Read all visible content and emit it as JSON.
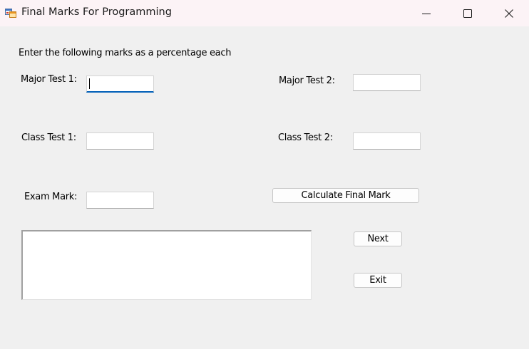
{
  "window": {
    "title": "Final Marks For Programming",
    "app_icon": "windows-form-icon",
    "controls": {
      "minimize_icon": "minimize-icon",
      "maximize_icon": "maximize-icon",
      "close_icon": "close-icon"
    }
  },
  "form": {
    "instruction": "Enter the following marks as a percentage each",
    "fields": {
      "major_test_1": {
        "label": "Major Test 1:",
        "value": ""
      },
      "major_test_2": {
        "label": "Major Test 2:",
        "value": ""
      },
      "class_test_1": {
        "label": "Class Test 1:",
        "value": ""
      },
      "class_test_2": {
        "label": "Class Test 2:",
        "value": ""
      },
      "exam_mark": {
        "label": "Exam Mark:",
        "value": ""
      }
    },
    "output": {
      "value": ""
    },
    "buttons": {
      "calculate": "Calculate Final Mark",
      "next": "Next",
      "exit": "Exit"
    }
  },
  "colors": {
    "titlebar_bg": "#fcf3f6",
    "form_bg": "#f0f0f0",
    "focus_accent": "#005fb8"
  }
}
